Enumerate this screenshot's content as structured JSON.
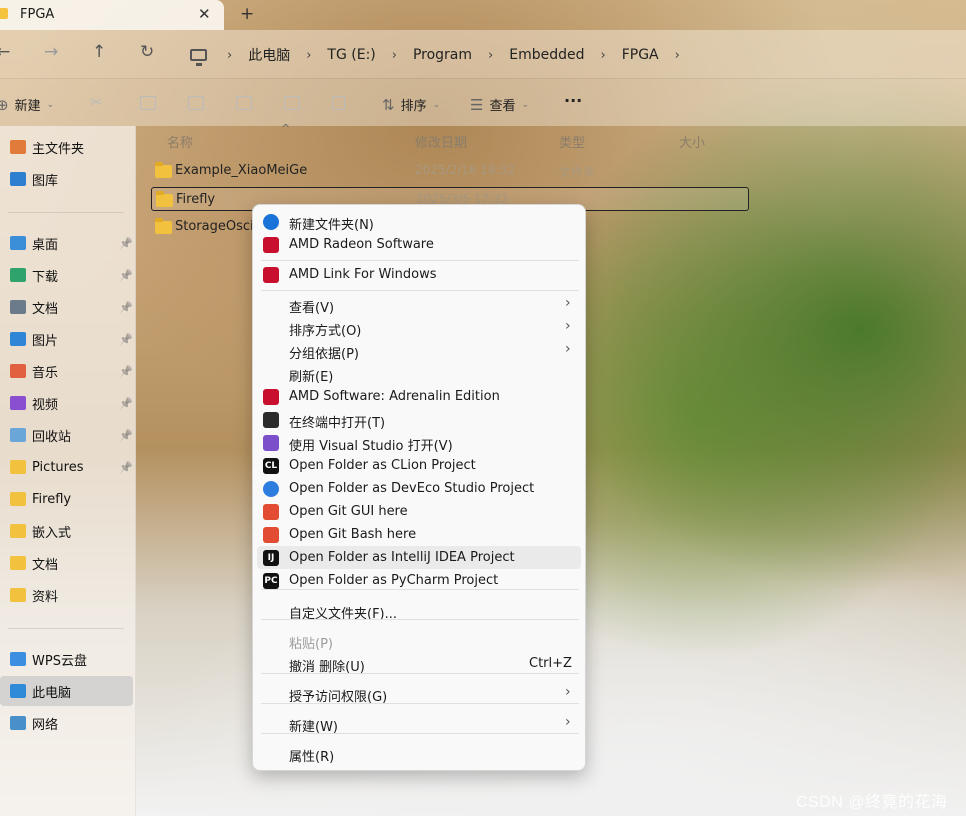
{
  "tab": {
    "title": "FPGA",
    "close": "✕",
    "new_tab": "+"
  },
  "nav": {
    "back": "←",
    "forward": "→",
    "up": "↑",
    "refresh": "↻",
    "breadcrumbs": [
      "此电脑",
      "TG (E:)",
      "Program",
      "Embedded",
      "FPGA"
    ],
    "sep": "›"
  },
  "commandbar": {
    "new_label": "新建",
    "sort_label": "排序",
    "view_label": "查看",
    "more": "···"
  },
  "sidebar": {
    "items": [
      {
        "label": "主文件夹",
        "icon": "home-icon",
        "color": "#e07b39"
      },
      {
        "label": "图库",
        "icon": "gallery-icon",
        "color": "#2f7fd1"
      },
      {
        "label": "桌面",
        "icon": "desktop-icon",
        "color": "#3a8fd8",
        "pinned": true
      },
      {
        "label": "下载",
        "icon": "download-icon",
        "color": "#2ea36b",
        "pinned": true
      },
      {
        "label": "文档",
        "icon": "documents-icon",
        "color": "#6b7b8c",
        "pinned": true
      },
      {
        "label": "图片",
        "icon": "pictures-icon",
        "color": "#2f86d6",
        "pinned": true
      },
      {
        "label": "音乐",
        "icon": "music-icon",
        "color": "#e0603f",
        "pinned": true
      },
      {
        "label": "视频",
        "icon": "videos-icon",
        "color": "#8a4fd0",
        "pinned": true
      },
      {
        "label": "回收站",
        "icon": "recycle-bin-icon",
        "color": "#6aa6d8",
        "pinned": true
      },
      {
        "label": "Pictures",
        "icon": "folder-icon",
        "color": "#f2c23f",
        "pinned": true
      },
      {
        "label": "Firefly",
        "icon": "folder-icon",
        "color": "#f2c23f"
      },
      {
        "label": "嵌入式",
        "icon": "folder-icon",
        "color": "#f2c23f"
      },
      {
        "label": "文档",
        "icon": "folder-icon",
        "color": "#f2c23f"
      },
      {
        "label": "资料",
        "icon": "folder-icon",
        "color": "#f2c23f"
      },
      {
        "label": "WPS云盘",
        "icon": "cloud-icon",
        "color": "#3b8ee0"
      },
      {
        "label": "此电脑",
        "icon": "this-pc-icon",
        "color": "#2f8ad8",
        "selected": true
      },
      {
        "label": "网络",
        "icon": "network-icon",
        "color": "#4a90c8"
      }
    ]
  },
  "columns": {
    "name": "名称",
    "modified": "修改日期",
    "type": "类型",
    "size": "大小"
  },
  "files": [
    {
      "name": "Example_XiaoMeiGe",
      "date": "2025/2/16 18:32",
      "type": "文件夹"
    },
    {
      "name": "Firefly",
      "date": "2025/3/5 17:32",
      "type": ""
    },
    {
      "name": "StorageOscill",
      "date": "",
      "type": ""
    }
  ],
  "context_menu": {
    "items": [
      {
        "label": "新建文件夹(N)",
        "icon": "new-folder-icon",
        "color": "#1a73d9"
      },
      {
        "label": "AMD Radeon Software",
        "icon": "amd-icon",
        "color": "#c8102e"
      },
      {
        "label": "AMD Link For Windows",
        "icon": "amd-icon",
        "color": "#c8102e"
      },
      {
        "label": "查看(V)",
        "submenu": true
      },
      {
        "label": "排序方式(O)",
        "submenu": true
      },
      {
        "label": "分组依据(P)",
        "submenu": true
      },
      {
        "label": "刷新(E)"
      },
      {
        "label": "AMD Software: Adrenalin Edition",
        "icon": "amd-icon",
        "color": "#c8102e"
      },
      {
        "label": "在终端中打开(T)",
        "icon": "terminal-icon",
        "color": "#2b2b2b"
      },
      {
        "label": "使用 Visual Studio 打开(V)",
        "icon": "visual-studio-icon",
        "color": "#7b4fc9"
      },
      {
        "label": "Open Folder as CLion Project",
        "icon": "clion-icon",
        "color": "#111111",
        "badge": "CL"
      },
      {
        "label": "Open Folder as DevEco Studio Project",
        "icon": "deveco-icon",
        "color": "#2d7de0"
      },
      {
        "label": "Open Git GUI here",
        "icon": "git-icon",
        "color": "#e24c32"
      },
      {
        "label": "Open Git Bash here",
        "icon": "git-icon",
        "color": "#e24c32"
      },
      {
        "label": "Open Folder as IntelliJ IDEA Project",
        "icon": "intellij-icon",
        "color": "#111111",
        "badge": "IJ",
        "hover": true
      },
      {
        "label": "Open Folder as PyCharm Project",
        "icon": "pycharm-icon",
        "color": "#111111",
        "badge": "PC"
      },
      {
        "label": "自定义文件夹(F)..."
      },
      {
        "label": "粘贴(P)",
        "disabled": true
      },
      {
        "label": "撤消 删除(U)",
        "shortcut": "Ctrl+Z"
      },
      {
        "label": "授予访问权限(G)",
        "submenu": true
      },
      {
        "label": "新建(W)",
        "submenu": true
      },
      {
        "label": "属性(R)"
      }
    ],
    "submenu_arrow": "›"
  },
  "watermark": "CSDN @终竟的花海"
}
